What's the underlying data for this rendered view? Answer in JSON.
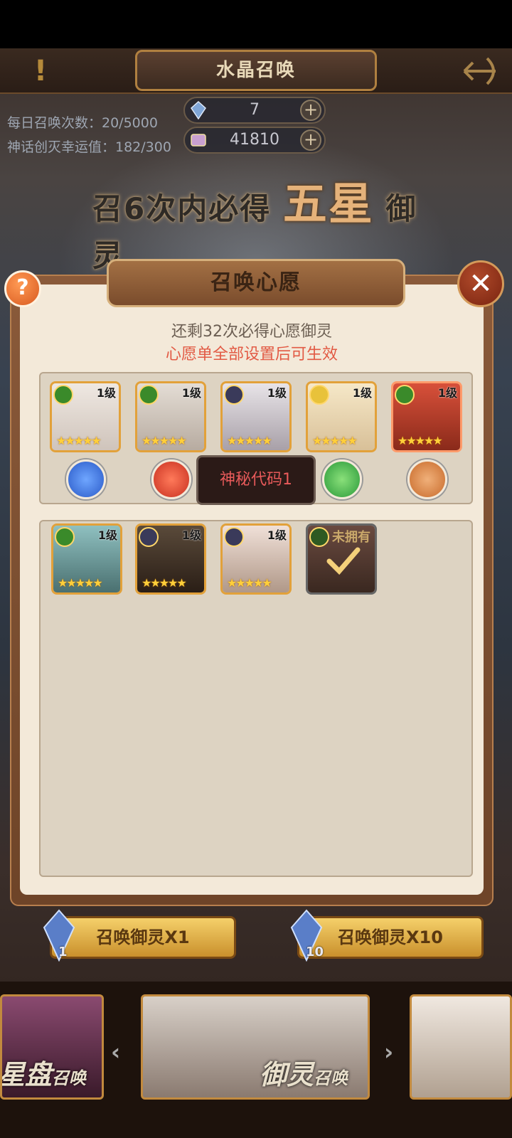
{
  "header": {
    "title": "水晶召唤",
    "alert_icon": "exclamation-icon",
    "back_icon": "bow-arrow-icon"
  },
  "resources": {
    "crystal_count": "7",
    "shard_count": "41810"
  },
  "info": {
    "daily_summons": "每日召唤次数：20/5000",
    "luck_value": "神话创灭幸运值：182/300"
  },
  "banner": {
    "prefix": "召6次内必得",
    "highlight": "五星",
    "suffix": "御灵"
  },
  "modal": {
    "title": "召唤心愿",
    "remaining_text": "还剩32次必得心愿御灵",
    "warning_text": "心愿单全部设置后可生效",
    "tooltip": "神秘代码1",
    "close_icon": "close-icon",
    "help_icon": "question-icon"
  },
  "wish_list": [
    {
      "level": "1级",
      "stars": "★★★★★",
      "element": "wind",
      "role": "shield",
      "face": "#d9d2cc"
    },
    {
      "level": "1级",
      "stars": "★★★★★",
      "element": "wind",
      "role": "sword",
      "face": "#c9c0b6"
    },
    {
      "level": "1级",
      "stars": "★★★★★",
      "element": "dark",
      "role": "",
      "face": "#c8c2c8"
    },
    {
      "level": "1级",
      "stars": "★★★★★",
      "element": "light",
      "role": "heal",
      "face": "#e8d8b8"
    },
    {
      "level": "1级",
      "stars": "★★★★★",
      "element": "wind",
      "role": "support",
      "face": "#c04030"
    }
  ],
  "pool_list": [
    {
      "level": "1级",
      "stars": "★★★★★",
      "element": "wind",
      "face": "#6fa0a0"
    },
    {
      "level": "1级",
      "stars": "★★★★★",
      "element": "dark",
      "face": "#4a3a30"
    },
    {
      "level": "1级",
      "stars": "★★★★★",
      "element": "dark",
      "face": "#d8c0b0"
    },
    {
      "element": "wind",
      "face": "#5a4038",
      "status": "未拥有"
    }
  ],
  "summon_buttons": [
    {
      "label": "召唤御灵X1",
      "count": "1"
    },
    {
      "label": "召唤御灵X10",
      "count": "10"
    }
  ],
  "bottom_cards": [
    {
      "label_main": "星盘",
      "label_sub": "召唤"
    },
    {
      "label_main": "御灵",
      "label_sub": "召唤"
    }
  ],
  "colors": {
    "accent_gold": "#e2a13a",
    "warning_red": "#e25a44",
    "panel_bg": "#f3e9d9"
  }
}
